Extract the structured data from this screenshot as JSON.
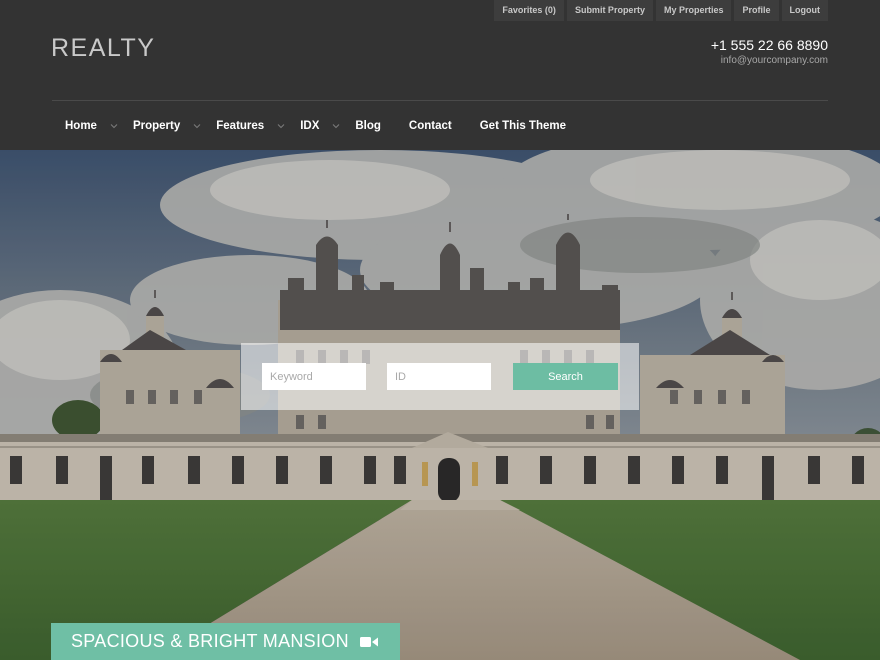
{
  "top_links": [
    "Favorites (0)",
    "Submit Property",
    "My Properties",
    "Profile",
    "Logout"
  ],
  "logo": "REALTY",
  "contact": {
    "phone": "+1 555 22 66 8890",
    "email": "info@yourcompany.com"
  },
  "nav": [
    {
      "label": "Home",
      "caret": true
    },
    {
      "label": "Property",
      "caret": true
    },
    {
      "label": "Features",
      "caret": true
    },
    {
      "label": "IDX",
      "caret": true
    },
    {
      "label": "Blog",
      "caret": false
    },
    {
      "label": "Contact",
      "caret": false
    },
    {
      "label": "Get This Theme",
      "caret": false
    }
  ],
  "search": {
    "keyword_placeholder": "Keyword",
    "id_placeholder": "ID",
    "button_label": "Search"
  },
  "caption": {
    "title": "SPACIOUS & BRIGHT MANSION",
    "icon": "video-camera-icon"
  },
  "colors": {
    "header_bg": "#333333",
    "accent": "#6dbda3"
  }
}
